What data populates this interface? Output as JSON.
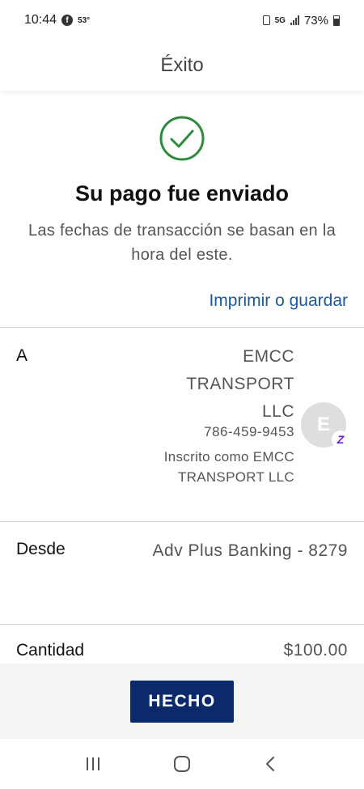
{
  "status_bar": {
    "time": "10:44",
    "temperature": "53°",
    "network": "5G",
    "battery": "73%"
  },
  "header": {
    "title": "Éxito"
  },
  "success": {
    "icon": "check-circle-icon",
    "accent_color": "#2e8b3a",
    "title": "Su pago fue enviado",
    "subtitle": "Las fechas de transacción se basan en la hora del este.",
    "print_link": "Imprimir o guardar",
    "link_color": "#1a5a9c"
  },
  "details": {
    "to_label": "A",
    "recipient_name": "EMCC TRANSPORT LLC",
    "recipient_phone": "786-459-9453",
    "recipient_enrolled": "Inscrito como EMCC TRANSPORT LLC",
    "avatar_initial": "E",
    "zelle_icon": "zelle-icon",
    "from_label": "Desde",
    "from_value": "Adv Plus Banking - 8279",
    "amount_label": "Cantidad",
    "amount_value": "$100.00"
  },
  "footer": {
    "done_label": "HECHO",
    "button_color": "#0c2a6b"
  },
  "nav": {
    "recent_icon": "recent-apps-icon",
    "home_icon": "home-icon",
    "back_icon": "back-icon"
  }
}
